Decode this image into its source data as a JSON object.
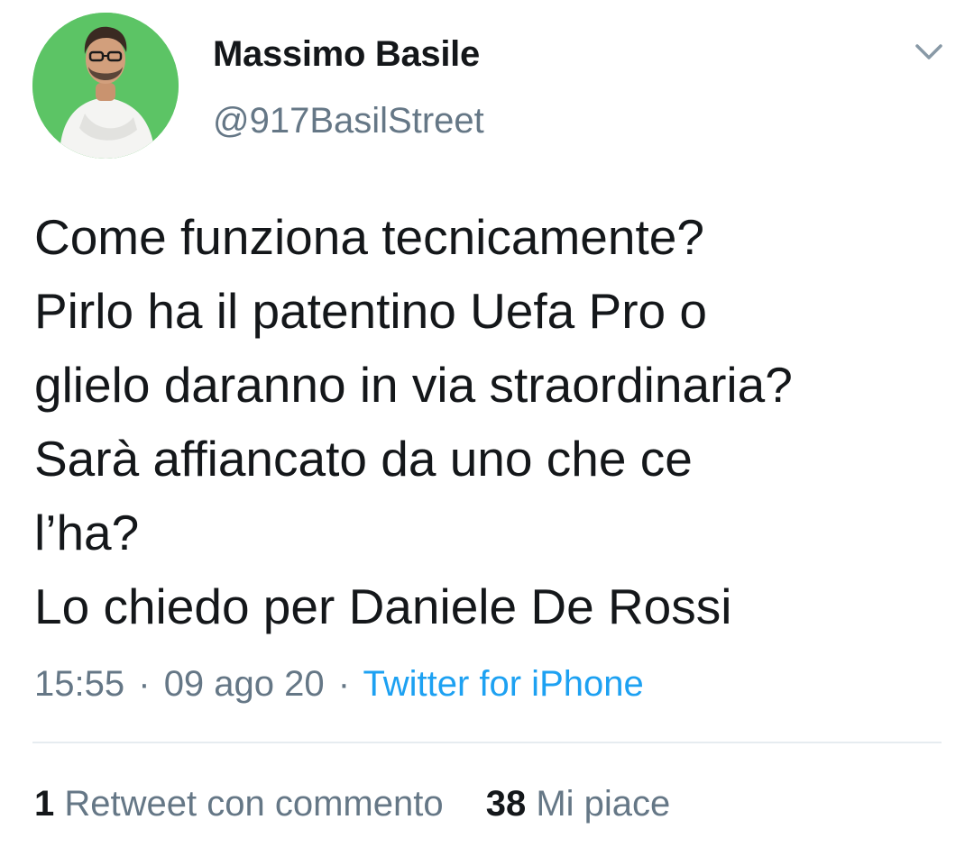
{
  "author": {
    "name": "Massimo Basile",
    "handle": "@917BasilStreet"
  },
  "menu": {
    "icon": "chevron-down-icon"
  },
  "tweet": {
    "lines": [
      "Come funziona tecnicamente?",
      "Pirlo ha il patentino Uefa Pro o",
      "glielo daranno in via straordinaria?",
      "Sarà affiancato da uno che ce",
      "l’ha?",
      "Lo chiedo per Daniele De Rossi"
    ]
  },
  "meta": {
    "time": "15:55",
    "date": "09 ago 20",
    "separator": "·",
    "source": "Twitter for iPhone"
  },
  "stats": {
    "retweets_count": "1",
    "retweets_label": "Retweet con commento",
    "likes_count": "38",
    "likes_label": "Mi piace"
  },
  "colors": {
    "text": "#14171a",
    "secondary": "#657786",
    "link": "#1da1f2",
    "divider": "#e6ecf0",
    "avatar_bg": "#5cc465"
  }
}
